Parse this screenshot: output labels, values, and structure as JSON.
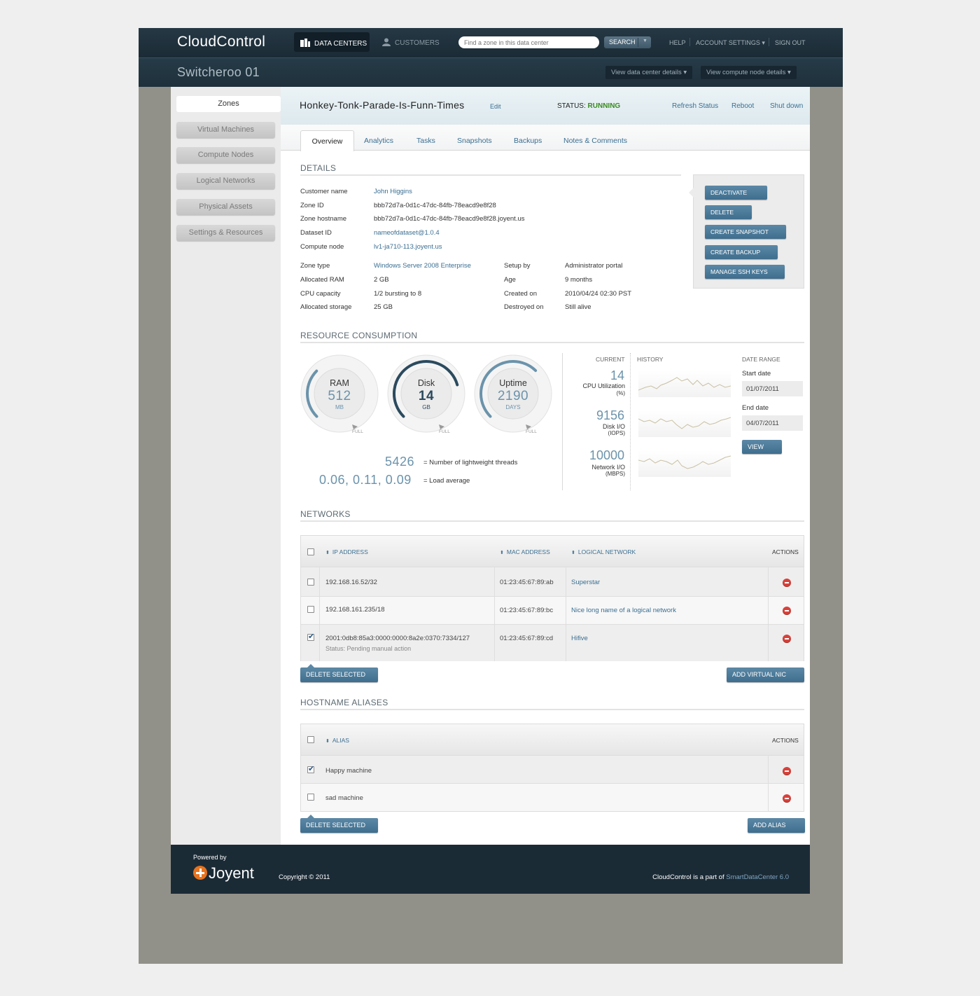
{
  "app": {
    "logo": "CloudControl",
    "nav": [
      {
        "label": "DATA CENTERS",
        "icon": "datacenter-icon"
      },
      {
        "label": "CUSTOMERS",
        "icon": "user-icon"
      }
    ],
    "search": {
      "placeholder": "Find a zone in this data center",
      "button": "SEARCH"
    },
    "links": [
      "HELP",
      "ACCOUNT SETTINGS",
      "SIGN OUT"
    ],
    "account_caret": "▾"
  },
  "subbar": {
    "title": "Switcheroo 01",
    "buttons": [
      "View data center details ▾",
      "View compute node details ▾"
    ]
  },
  "sidebar": {
    "items": [
      "Zones",
      "Virtual Machines",
      "Compute Nodes",
      "Logical Networks",
      "Physical Assets",
      "Settings & Resources"
    ],
    "active": 0
  },
  "zone": {
    "name": "Honkey-Tonk-Parade-Is-Funn-Times",
    "edit": "Edit",
    "status_label": "STATUS:",
    "status_value": "RUNNING",
    "actions": [
      "Refresh Status",
      "Reboot",
      "Shut down"
    ]
  },
  "tabs": [
    "Overview",
    "Analytics",
    "Tasks",
    "Snapshots",
    "Backups",
    "Notes & Comments"
  ],
  "details": {
    "title": "DETAILS",
    "rows1": [
      {
        "label": "Customer name",
        "value": "John Higgins",
        "link": true
      },
      {
        "label": "Zone ID",
        "value": "bbb72d7a-0d1c-47dc-84fb-78eacd9e8f28",
        "link": false
      },
      {
        "label": "Zone hostname",
        "value": "bbb72d7a-0d1c-47dc-84fb-78eacd9e8f28.joyent.us",
        "link": false
      },
      {
        "label": "Dataset ID",
        "value": "nameofdataset@1.0.4",
        "link": true
      },
      {
        "label": "Compute node",
        "value": "lv1-ja710-113.joyent.us",
        "link": true
      }
    ],
    "rows2": [
      {
        "label": "Zone type",
        "value": "Windows Server 2008 Enterprise",
        "link": true
      },
      {
        "label": "Allocated RAM",
        "value": "2 GB",
        "link": false
      },
      {
        "label": "CPU capacity",
        "value": "1/2 bursting to 8",
        "link": false
      },
      {
        "label": "Allocated storage",
        "value": "25 GB",
        "link": false
      }
    ],
    "rows3": [
      {
        "label": "Setup by",
        "value": "Administrator portal"
      },
      {
        "label": "Age",
        "value": "9 months"
      },
      {
        "label": "Created on",
        "value": "2010/04/24 02:30 PST"
      },
      {
        "label": "Destroyed on",
        "value": "Still alive"
      }
    ],
    "action_buttons": [
      "DEACTIVATE",
      "DELETE",
      "CREATE SNAPSHOT",
      "CREATE BACKUP",
      "MANAGE SSH KEYS"
    ]
  },
  "resources": {
    "title": "RESOURCE CONSUMPTION",
    "gauges": [
      {
        "label": "RAM",
        "value": "512",
        "unit": "MB",
        "full": "FULL",
        "fraction": 0.3
      },
      {
        "label": "Disk",
        "value": "14",
        "unit": "GB",
        "full": "FULL",
        "fraction": 0.7
      },
      {
        "label": "Uptime",
        "value": "2190",
        "unit": "DAYS",
        "full": "FULL",
        "fraction": 0.6
      }
    ],
    "threads_value": "5426",
    "threads_label": "= Number of lightweight threads",
    "load_value": "0.06, 0.11, 0.09",
    "load_label": "= Load average",
    "current_heading": "CURRENT",
    "history_heading": "HISTORY",
    "metrics": [
      {
        "value": "14",
        "label": "CPU Utilization",
        "unit": "(%)"
      },
      {
        "value": "9156",
        "label": "Disk I/O",
        "unit": "(IOPS)"
      },
      {
        "value": "10000",
        "label": "Network I/O",
        "unit": "(MBPS)"
      }
    ],
    "date_range": {
      "heading": "DATE RANGE",
      "start_label": "Start date",
      "start_value": "01/07/2011",
      "end_label": "End date",
      "end_value": "04/07/2011",
      "button": "VIEW"
    }
  },
  "networks": {
    "title": "NETWORKS",
    "columns": [
      "IP ADDRESS",
      "MAC ADDRESS",
      "LOGICAL NETWORK",
      "ACTIONS"
    ],
    "rows": [
      {
        "ip": "192.168.16.52/32",
        "mac": "01:23:45:67:89:ab",
        "network": "Superstar",
        "checked": false,
        "status": ""
      },
      {
        "ip": "192.168.161.235/18",
        "mac": "01:23:45:67:89:bc",
        "network": "Nice long name of a logical network",
        "checked": false,
        "status": ""
      },
      {
        "ip": "2001:0db8:85a3:0000:0000:8a2e:0370:7334/127",
        "mac": "01:23:45:67:89:cd",
        "network": "Hifive",
        "checked": true,
        "status": "Status: Pending manual action"
      }
    ],
    "delete_button": "DELETE SELECTED",
    "add_button": "ADD VIRTUAL NIC"
  },
  "aliases": {
    "title": "HOSTNAME ALIASES",
    "columns": [
      "ALIAS",
      "ACTIONS"
    ],
    "rows": [
      {
        "alias": "Happy machine",
        "checked": true
      },
      {
        "alias": "sad machine",
        "checked": false
      }
    ],
    "delete_button": "DELETE SELECTED",
    "add_button": "ADD ALIAS"
  },
  "footer": {
    "powered_by": "Powered by",
    "brand": "Joyent",
    "copyright": "Copyright © 2011",
    "part_of_prefix": "CloudControl is a part of ",
    "part_of_link": "SmartDataCenter 6.0"
  },
  "colors": {
    "header_bg": "#1b2b36",
    "accent": "#3b6f92",
    "button": "#4b7a99",
    "status_running": "#3a8a20",
    "remove": "#d9413a",
    "joyent_orange": "#e8731d"
  }
}
